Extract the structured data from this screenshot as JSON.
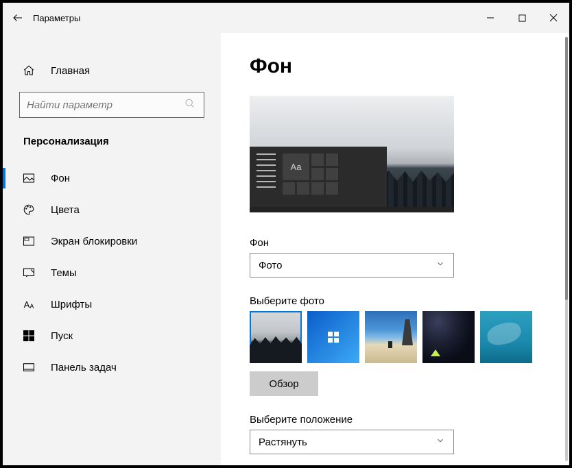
{
  "window": {
    "title": "Параметры"
  },
  "sidebar": {
    "home": "Главная",
    "search_placeholder": "Найти параметр",
    "section": "Персонализация",
    "items": [
      {
        "label": "Фон",
        "icon": "picture"
      },
      {
        "label": "Цвета",
        "icon": "palette"
      },
      {
        "label": "Экран блокировки",
        "icon": "lockscreen"
      },
      {
        "label": "Темы",
        "icon": "brush"
      },
      {
        "label": "Шрифты",
        "icon": "fonts"
      },
      {
        "label": "Пуск",
        "icon": "start"
      },
      {
        "label": "Панель задач",
        "icon": "taskbar"
      }
    ]
  },
  "page": {
    "title": "Фон",
    "preview_sample": "Aa",
    "bg_label": "Фон",
    "bg_value": "Фото",
    "choose_label": "Выберите фото",
    "browse": "Обзор",
    "fit_label": "Выберите положение",
    "fit_value": "Растянуть"
  }
}
